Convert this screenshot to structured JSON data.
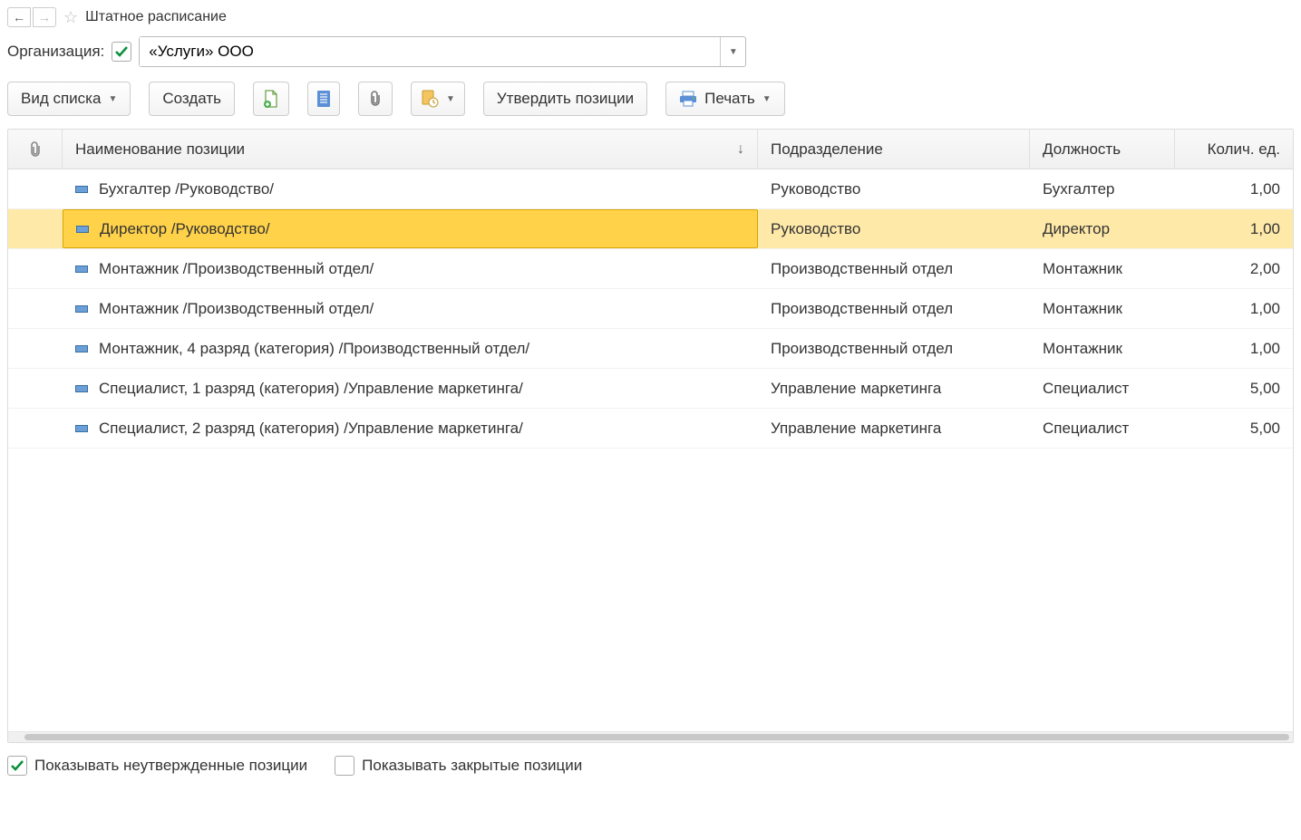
{
  "header": {
    "title": "Штатное расписание"
  },
  "organization": {
    "label": "Организация:",
    "value": "«Услуги» ООО",
    "checked": true
  },
  "toolbar": {
    "view_list": "Вид списка",
    "create": "Создать",
    "approve": "Утвердить позиции",
    "print": "Печать"
  },
  "columns": {
    "name": "Наименование позиции",
    "dept": "Подразделение",
    "position": "Должность",
    "qty": "Колич. ед."
  },
  "rows": [
    {
      "name": "Бухгалтер /Руководство/",
      "dept": "Руководство",
      "position": "Бухгалтер",
      "qty": "1,00",
      "selected": false
    },
    {
      "name": "Директор /Руководство/",
      "dept": "Руководство",
      "position": "Директор",
      "qty": "1,00",
      "selected": true
    },
    {
      "name": "Монтажник /Производственный отдел/",
      "dept": "Производственный отдел",
      "position": "Монтажник",
      "qty": "2,00",
      "selected": false
    },
    {
      "name": "Монтажник /Производственный отдел/",
      "dept": "Производственный отдел",
      "position": "Монтажник",
      "qty": "1,00",
      "selected": false
    },
    {
      "name": "Монтажник, 4 разряд (категория) /Производственный отдел/",
      "dept": "Производственный отдел",
      "position": "Монтажник",
      "qty": "1,00",
      "selected": false
    },
    {
      "name": "Специалист, 1 разряд (категория) /Управление маркетинга/",
      "dept": "Управление маркетинга",
      "position": "Специалист",
      "qty": "5,00",
      "selected": false
    },
    {
      "name": "Специалист, 2 разряд (категория) /Управление маркетинга/",
      "dept": "Управление маркетинга",
      "position": "Специалист",
      "qty": "5,00",
      "selected": false
    }
  ],
  "footer": {
    "show_unapproved": "Показывать неутвержденные позиции",
    "show_closed": "Показывать закрытые позиции",
    "show_unapproved_checked": true,
    "show_closed_checked": false
  }
}
